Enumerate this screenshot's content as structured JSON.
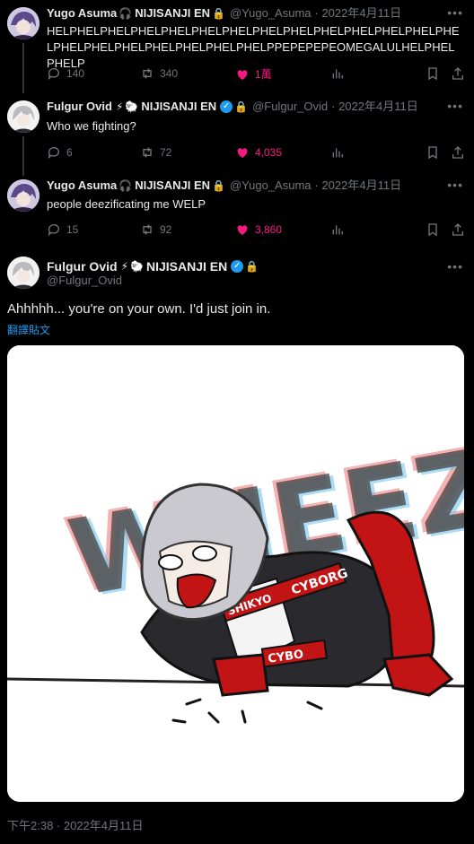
{
  "tweets": [
    {
      "name": "Yugo Asuma",
      "suffix": "NIJISANJI EN",
      "handle": "@Yugo_Asuma",
      "date": "· 2022年4月11日",
      "text": "HELPHELPHELPHELPHELPHELPHELPHELPHELPHELPHELPHELPHELPHELPHELPHELPHELPHELPHELPHELPHELPPEPEPEPEOMEGALULHELPHELPHELP",
      "replies": "140",
      "retweets": "340",
      "likes": "1萬"
    },
    {
      "name": "Fulgur Ovid",
      "suffix": "NIJISANJI EN",
      "handle": "@Fulgur_Ovid",
      "date": "· 2022年4月11日",
      "text": "Who we fighting?",
      "replies": "6",
      "retweets": "72",
      "likes": "4,035"
    },
    {
      "name": "Yugo Asuma",
      "suffix": "NIJISANJI EN",
      "handle": "@Yugo_Asuma",
      "date": "· 2022年4月11日",
      "text": "people deezificating me WELP",
      "replies": "15",
      "retweets": "92",
      "likes": "3,860"
    }
  ],
  "main": {
    "name": "Fulgur Ovid",
    "suffix": "NIJISANJI EN",
    "handle": "@Fulgur_Ovid",
    "text": "Ahhhhh... you're on your own. I'd just join in.",
    "translate": "翻譯貼文",
    "timestamp": "下午2:38 · 2022年4月11日"
  },
  "image": {
    "sfx": "WHEEZE",
    "strap1": "CYBORG",
    "strap2": "SHIKYO",
    "strap3": "CYBO"
  },
  "colors": {
    "accent": "#1d9bf0",
    "like": "#f91880",
    "muted": "#71767b"
  },
  "icons": [
    "headphones-icon",
    "lock-icon",
    "lightning-icon",
    "sheep-icon",
    "verified-icon",
    "reply-icon",
    "retweet-icon",
    "heart-icon",
    "analytics-icon",
    "bookmark-icon",
    "share-icon",
    "more-icon"
  ]
}
